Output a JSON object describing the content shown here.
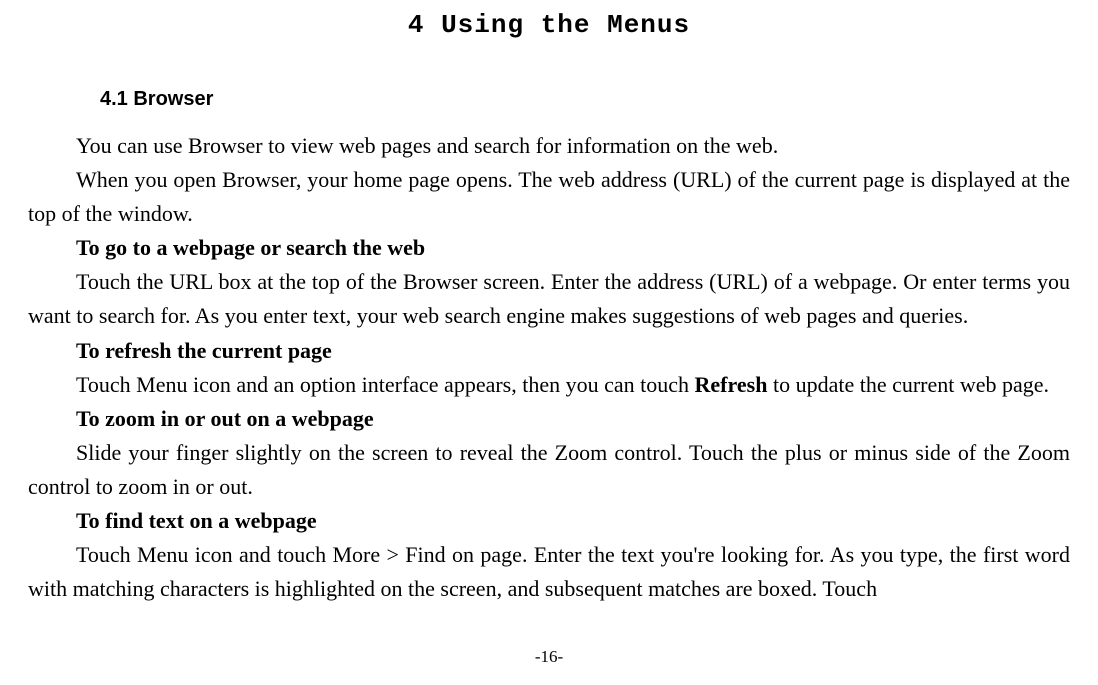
{
  "chapter_title": "4 Using the Menus",
  "section_title": "4.1   Browser",
  "paragraphs": {
    "p1": "You can use Browser to view web pages and search for information on the web.",
    "p2": "When you open Browser, your home page opens. The web address (URL) of the current page is displayed at the top of the window.",
    "h1": "To go to a webpage or search the web",
    "p3": "Touch the URL box at the top of the Browser screen. Enter the address (URL) of a webpage. Or enter terms you want to search for. As you enter text, your web search engine makes suggestions of web pages and queries.",
    "h2": "To refresh the current page",
    "p4_before": "Touch Menu icon and an option interface appears, then you can touch ",
    "p4_bold": "Refresh",
    "p4_after": " to update the current web page.",
    "h3": "To zoom in or out on a webpage",
    "p5": "Slide your finger slightly on the screen to reveal the Zoom control. Touch the plus or minus side of the Zoom control to zoom in or out.",
    "h4": "To find text on a webpage",
    "p6": "Touch Menu icon and touch More > Find on page. Enter the text you're looking for. As you type, the first word with matching characters is highlighted on the screen, and subsequent matches are boxed. Touch"
  },
  "page_number": "-16-"
}
